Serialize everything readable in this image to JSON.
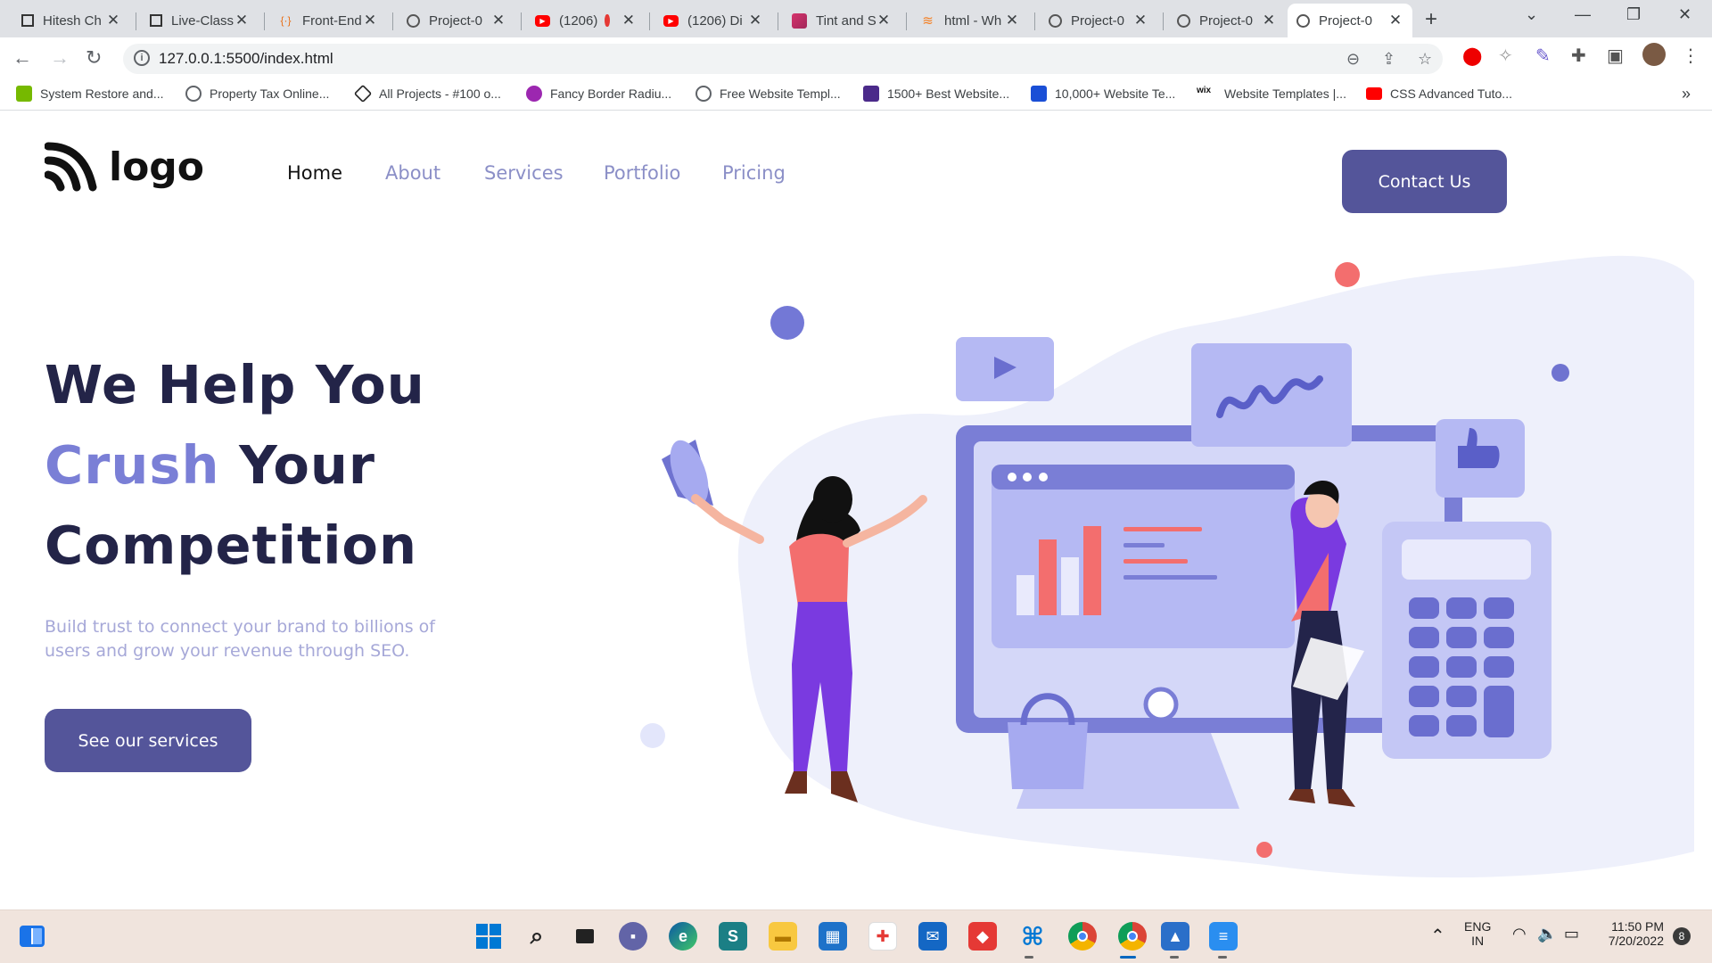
{
  "browser": {
    "tabs": [
      {
        "title": "Hitesh Ch",
        "icon": "square-icon"
      },
      {
        "title": "Live-Class",
        "icon": "square-icon"
      },
      {
        "title": "Front-End",
        "icon": "code-icon"
      },
      {
        "title": "Project-0",
        "icon": "globe-icon"
      },
      {
        "title": "(1206)",
        "icon": "youtube-icon"
      },
      {
        "title": "(1206) Di",
        "icon": "youtube-icon"
      },
      {
        "title": "Tint and S",
        "icon": "gradient-icon"
      },
      {
        "title": "html - Wh",
        "icon": "stackoverflow-icon"
      },
      {
        "title": "Project-0",
        "icon": "globe-icon"
      },
      {
        "title": "Project-0",
        "icon": "globe-icon"
      },
      {
        "title": "Project-0",
        "icon": "globe-icon"
      }
    ],
    "url": "127.0.0.1:5500/index.html",
    "bookmarks": [
      {
        "label": "System Restore and...",
        "color": "#76b900"
      },
      {
        "label": "Property Tax Online...",
        "color": "#5f6368"
      },
      {
        "label": "All Projects - #100 o...",
        "color": "#222222"
      },
      {
        "label": "Fancy Border Radiu...",
        "color": "#9c27b0"
      },
      {
        "label": "Free Website Templ...",
        "color": "#5f6368"
      },
      {
        "label": "1500+ Best Website...",
        "color": "#4b2a8a"
      },
      {
        "label": "10,000+ Website Te...",
        "color": "#1a4fd6"
      },
      {
        "label": "Website Templates |...",
        "color": "#111111"
      },
      {
        "label": "CSS Advanced Tuto...",
        "color": "#ff0000"
      }
    ]
  },
  "site": {
    "logo": "logo",
    "nav": [
      "Home",
      "About",
      "Services",
      "Portfolio",
      "Pricing"
    ],
    "contact": "Contact Us",
    "hero": {
      "line1": "We Help You",
      "line2_accent": "Crush",
      "line2_rest": "Your",
      "line3": "Competition",
      "sub": "Build trust to connect your brand to billions of users and grow your revenue through SEO.",
      "cta": "See our services"
    },
    "colors": {
      "primary": "#54559a",
      "accent": "#7a7fd6",
      "heading": "#232448"
    }
  },
  "taskbar": {
    "lang": "ENG",
    "region": "IN",
    "time": "11:50 PM",
    "date": "7/20/2022",
    "notifications": "8"
  }
}
